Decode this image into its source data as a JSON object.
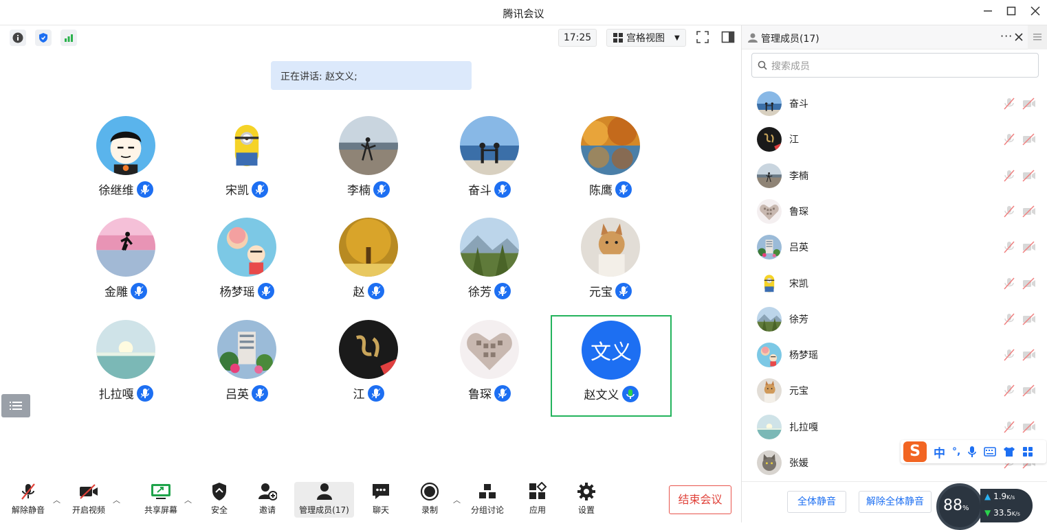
{
  "window": {
    "title": "腾讯会议"
  },
  "topbar": {
    "time": "17:25",
    "view_label": "宫格视图"
  },
  "speaking": {
    "text": "正在讲话: 赵文义;"
  },
  "colors": {
    "accent": "#1d6ff2",
    "active_border": "#23b35c",
    "end_red": "#e0423a",
    "speaking_bg": "#dce9fb"
  },
  "grid": [
    {
      "name": "徐继维",
      "avatar": "cartoon-boy"
    },
    {
      "name": "宋凯",
      "avatar": "minion"
    },
    {
      "name": "李楠",
      "avatar": "beach-dance"
    },
    {
      "name": "奋斗",
      "avatar": "sea-couple"
    },
    {
      "name": "陈鹰",
      "avatar": "autumn-lake"
    },
    {
      "name": "金雕",
      "avatar": "runner-sunset"
    },
    {
      "name": "杨梦瑶",
      "avatar": "cartoon-family"
    },
    {
      "name": "赵",
      "avatar": "golden-tree"
    },
    {
      "name": "徐芳",
      "avatar": "mountain-forest"
    },
    {
      "name": "元宝",
      "avatar": "dog"
    },
    {
      "name": "扎拉嘎",
      "avatar": "sea-sunrise"
    },
    {
      "name": "吕英",
      "avatar": "building-flowers"
    },
    {
      "name": "江",
      "avatar": "calligraphy"
    },
    {
      "name": "鲁琛",
      "avatar": "photo-heart"
    },
    {
      "name": "赵文义",
      "avatar_text": "文义",
      "active": true
    }
  ],
  "toolbar": {
    "unmute": "解除静音",
    "video": "开启视频",
    "share": "共享屏幕",
    "security": "安全",
    "invite": "邀请",
    "members": "管理成员(17)",
    "chat": "聊天",
    "record": "录制",
    "breakout": "分组讨论",
    "apps": "应用",
    "settings": "设置",
    "end": "结束会议"
  },
  "panel": {
    "title": "管理成员(17)",
    "search_placeholder": "搜索成员",
    "members": [
      {
        "name": "奋斗",
        "avatar": "sea-couple"
      },
      {
        "name": "江",
        "avatar": "calligraphy"
      },
      {
        "name": "李楠",
        "avatar": "beach-dance"
      },
      {
        "name": "鲁琛",
        "avatar": "photo-heart"
      },
      {
        "name": "吕英",
        "avatar": "building-flowers"
      },
      {
        "name": "宋凯",
        "avatar": "minion"
      },
      {
        "name": "徐芳",
        "avatar": "mountain-forest"
      },
      {
        "name": "杨梦瑶",
        "avatar": "cartoon-family"
      },
      {
        "name": "元宝",
        "avatar": "dog"
      },
      {
        "name": "扎拉嘎",
        "avatar": "sea-sunrise"
      },
      {
        "name": "张媛",
        "avatar": "cat"
      }
    ],
    "mute_all": "全体静音",
    "unmute_all": "解除全体静音"
  },
  "ime": {
    "lang": "中",
    "punct": "°,"
  },
  "net_gauge": {
    "percent": "88",
    "percent_unit": "%",
    "up": "1.9",
    "down": "33.5",
    "rate_unit": "K/s"
  }
}
